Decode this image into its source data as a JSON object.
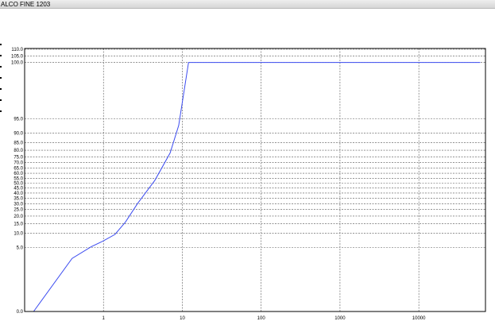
{
  "window": {
    "title": "ALCO FINE 1203"
  },
  "colors": {
    "line": "#3b4bf0",
    "grid": "#555555",
    "axis": "#000000",
    "titlebar": "#e3e3e3"
  },
  "chart_data": {
    "type": "line",
    "title": "",
    "xlabel": "",
    "ylabel": "",
    "x_scale": "log",
    "xlim": [
      0.1,
      70000
    ],
    "x_ticks": [
      1,
      10,
      100,
      1000,
      10000
    ],
    "x_tick_labels": [
      "1",
      "10",
      "100",
      "1000",
      "10000"
    ],
    "y_scale": "probability",
    "ylim": [
      0.0,
      110.0
    ],
    "y_ticks": [
      0,
      5,
      10,
      15,
      20,
      25,
      30,
      35,
      40,
      45,
      50,
      55,
      60,
      65,
      70,
      75,
      80,
      85,
      90,
      95,
      100,
      105,
      110
    ],
    "y_tick_labels": [
      "0.0",
      "5.0",
      "10.0",
      "15.0",
      "20.0",
      "25.0",
      "30.0",
      "35.0",
      "40.0",
      "45.0",
      "50.0",
      "55.0",
      "60.0",
      "65.0",
      "70.0",
      "75.0",
      "80.0",
      "85.0",
      "90.0",
      "95.0",
      "100.0",
      "105.0",
      "110.0"
    ],
    "grid": true,
    "series": [
      {
        "name": "",
        "x": [
          0.13,
          0.4,
          0.7,
          1.0,
          1.4,
          1.9,
          2.7,
          4.5,
          7.0,
          9.0,
          12.0,
          60000
        ],
        "y": [
          0.0,
          2.7,
          5.2,
          7.0,
          9.5,
          16.0,
          30.0,
          53.0,
          78.0,
          93.0,
          100.0,
          100.0
        ]
      }
    ]
  }
}
